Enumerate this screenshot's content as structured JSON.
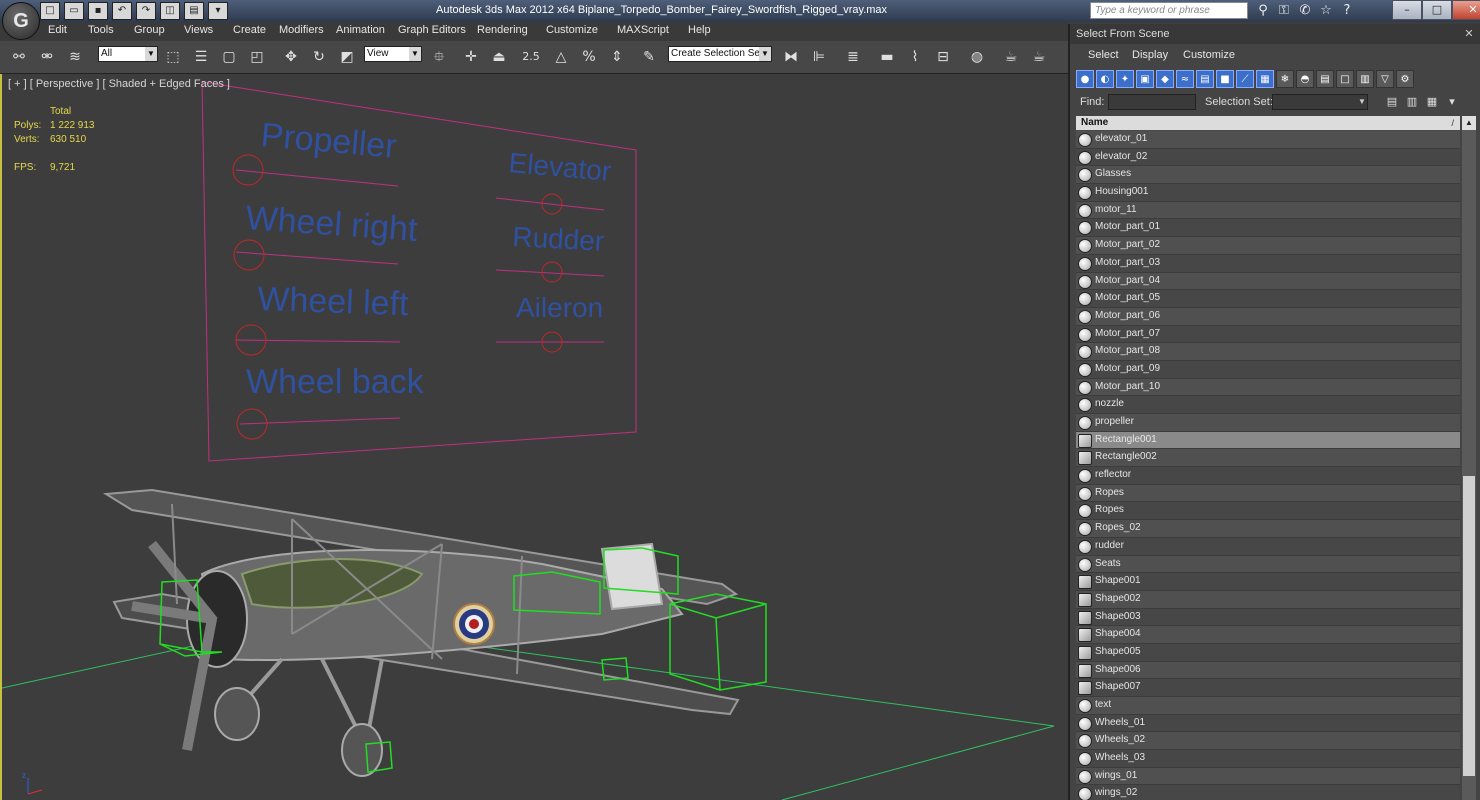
{
  "window": {
    "title": "Autodesk 3ds Max  2012 x64      Biplane_Torpedo_Bomber_Fairey_Swordfish_Rigged_vray.max",
    "search_placeholder": "Type a keyword or phrase",
    "logo_glyph": "G"
  },
  "menu": [
    "Edit",
    "Tools",
    "Group",
    "Views",
    "Create",
    "Modifiers",
    "Animation",
    "Graph Editors",
    "Rendering",
    "Customize",
    "MAXScript",
    "Help"
  ],
  "toolbar": {
    "filter_value": "All",
    "coord_value": "View",
    "selection_set_placeholder": "Create Selection Se",
    "snap_value": "2.5"
  },
  "viewport": {
    "label": "[ + ] [ Perspective ] [ Shaded + Edged Faces ]",
    "stats": {
      "total_label": "Total",
      "polys_label": "Polys:",
      "polys_value": "1 222 913",
      "verts_label": "Verts:",
      "verts_value": "630 510",
      "fps_label": "FPS:",
      "fps_value": "9,721"
    },
    "rig_panel": {
      "labels_left": [
        "Propeller",
        "Wheel right",
        "Wheel left",
        "Wheel back"
      ],
      "labels_right": [
        "Elevator",
        "Rudder",
        "Aileron"
      ]
    },
    "colors": {
      "panel_border": "#c03080",
      "label_text": "#3050a0",
      "control_circle": "#c02828",
      "bounding_box": "#22dd22",
      "grid_line": "#30c060"
    }
  },
  "dialog": {
    "title": "Select From Scene",
    "close_glyph": "✕",
    "menu": [
      "Select",
      "Display",
      "Customize"
    ],
    "find_label": "Find:",
    "selection_set_label": "Selection Set:",
    "column_header": "Name",
    "objects": [
      {
        "name": "elevator_01",
        "type": "geometry"
      },
      {
        "name": "elevator_02",
        "type": "geometry"
      },
      {
        "name": "Glasses",
        "type": "geometry"
      },
      {
        "name": "Housing001",
        "type": "geometry"
      },
      {
        "name": "motor_11",
        "type": "geometry"
      },
      {
        "name": "Motor_part_01",
        "type": "geometry"
      },
      {
        "name": "Motor_part_02",
        "type": "geometry"
      },
      {
        "name": "Motor_part_03",
        "type": "geometry"
      },
      {
        "name": "Motor_part_04",
        "type": "geometry"
      },
      {
        "name": "Motor_part_05",
        "type": "geometry"
      },
      {
        "name": "Motor_part_06",
        "type": "geometry"
      },
      {
        "name": "Motor_part_07",
        "type": "geometry"
      },
      {
        "name": "Motor_part_08",
        "type": "geometry"
      },
      {
        "name": "Motor_part_09",
        "type": "geometry"
      },
      {
        "name": "Motor_part_10",
        "type": "geometry"
      },
      {
        "name": "nozzle",
        "type": "geometry"
      },
      {
        "name": "propeller",
        "type": "geometry"
      },
      {
        "name": "Rectangle001",
        "type": "shape",
        "selected": true
      },
      {
        "name": "Rectangle002",
        "type": "shape"
      },
      {
        "name": "reflector",
        "type": "geometry"
      },
      {
        "name": "Ropes",
        "type": "geometry"
      },
      {
        "name": "Ropes",
        "type": "geometry"
      },
      {
        "name": "Ropes_02",
        "type": "geometry"
      },
      {
        "name": "rudder",
        "type": "geometry"
      },
      {
        "name": "Seats",
        "type": "geometry"
      },
      {
        "name": "Shape001",
        "type": "shape"
      },
      {
        "name": "Shape002",
        "type": "shape"
      },
      {
        "name": "Shape003",
        "type": "shape"
      },
      {
        "name": "Shape004",
        "type": "shape"
      },
      {
        "name": "Shape005",
        "type": "shape"
      },
      {
        "name": "Shape006",
        "type": "shape"
      },
      {
        "name": "Shape007",
        "type": "shape"
      },
      {
        "name": "text",
        "type": "geometry"
      },
      {
        "name": "Wheels_01",
        "type": "geometry"
      },
      {
        "name": "Wheels_02",
        "type": "geometry"
      },
      {
        "name": "Wheels_03",
        "type": "geometry"
      },
      {
        "name": "wings_01",
        "type": "geometry"
      },
      {
        "name": "wings_02",
        "type": "geometry"
      }
    ]
  }
}
